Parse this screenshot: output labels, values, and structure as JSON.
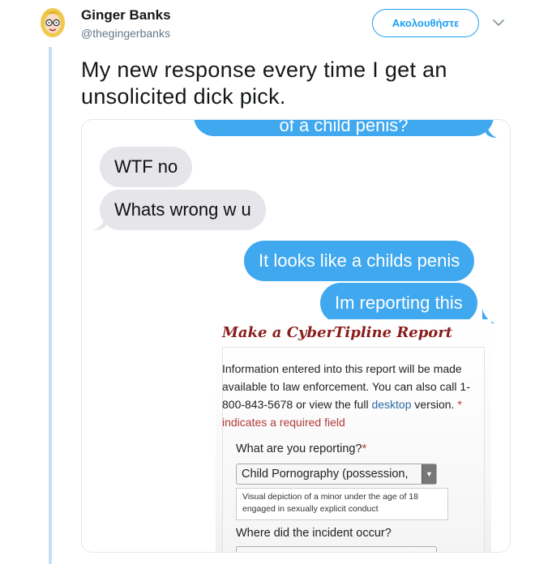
{
  "author": {
    "name": "Ginger Banks",
    "handle": "@thegingerbanks"
  },
  "follow_button": {
    "label": "Ακολουθήστε"
  },
  "tweet": {
    "text_line1": "My new response every time I get an",
    "text_line2": "unsolicited dick pick."
  },
  "screenshot": {
    "top_bubble": "of a child penis?",
    "messages_received": [
      "WTF no",
      "Whats wrong w u"
    ],
    "messages_sent": [
      "It looks like a childs penis",
      "Im reporting this"
    ],
    "report": {
      "title": "Make a CyberTipline Report",
      "info_line1": "Information entered into this report will be made",
      "info_line2": "available to law enforcement. You can also call 1-",
      "info_line3_a": "800-843-5678 or view the full ",
      "info_line3_link": "desktop",
      "info_line3_b": " version. ",
      "info_star": "*",
      "info_line4": "indicates a required field",
      "q1_label": "What are you reporting?",
      "q1_star": "*",
      "q1_selected": "Child Pornography (possession,",
      "q1_help_line1": "Visual depiction of a minor under the age of 18",
      "q1_help_line2": "engaged in sexually explicit conduct",
      "q2_label": "Where did the incident occur?"
    }
  },
  "colors": {
    "twitter_blue": "#1da1f2",
    "imessage_blue": "#40a8ef",
    "imessage_gray": "#e5e5ea",
    "report_title": "#8b1d1d"
  },
  "icons": {
    "avatar": "avatar-cartoon-woman",
    "menu": "chevron-down-icon"
  }
}
